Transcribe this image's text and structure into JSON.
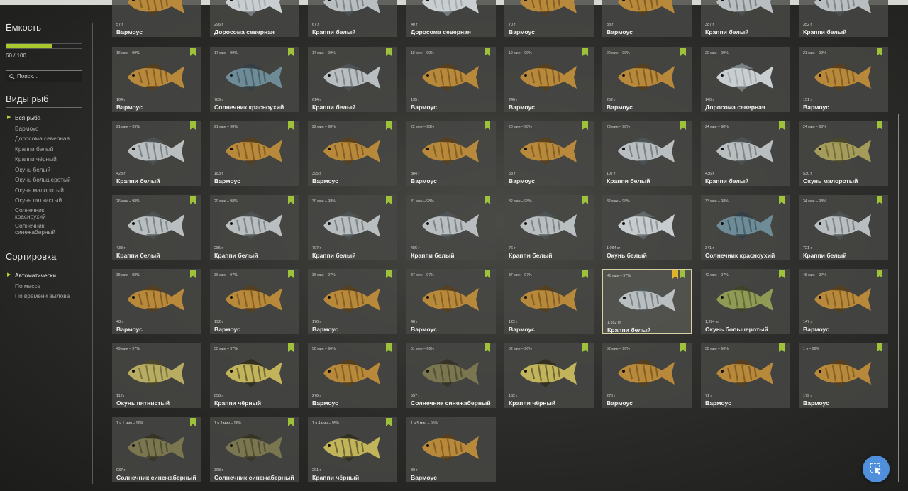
{
  "sidebar": {
    "capacity": {
      "title": "Ёмкость",
      "value": "60 / 100",
      "fraction": 0.6
    },
    "search": {
      "placeholder": "Поиск..."
    },
    "species": {
      "title": "Виды рыб",
      "items": [
        {
          "label": "Вся рыба",
          "active": true
        },
        {
          "label": "Вармоус",
          "active": false
        },
        {
          "label": "Доросома северная",
          "active": false
        },
        {
          "label": "Краппи белый",
          "active": false
        },
        {
          "label": "Краппи чёрный",
          "active": false
        },
        {
          "label": "Окунь белый",
          "active": false
        },
        {
          "label": "Окунь большеротый",
          "active": false
        },
        {
          "label": "Окунь малоротый",
          "active": false
        },
        {
          "label": "Окунь пятнистый",
          "active": false
        },
        {
          "label": "Солнечник красноухий",
          "active": false
        },
        {
          "label": "Солнечник синежаберный",
          "active": false
        }
      ]
    },
    "sort": {
      "title": "Сортировка",
      "items": [
        {
          "label": "Автоматически",
          "active": true
        },
        {
          "label": "По массе",
          "active": false
        },
        {
          "label": "По времени вылова",
          "active": false
        }
      ]
    }
  },
  "colors": {
    "accent": "#a8c82e",
    "badge": "#9ec23a",
    "star_badge": "#e0b32a",
    "help_button": "#4f8fdc"
  },
  "fish_cards": [
    {
      "info": "",
      "weight": "57 г",
      "name": "Вармоус",
      "badge": false
    },
    {
      "info": "",
      "weight": "296 г",
      "name": "Доросома северная",
      "badge": false
    },
    {
      "info": "",
      "weight": "67 г",
      "name": "Краппи белый",
      "badge": false
    },
    {
      "info": "",
      "weight": "40 г",
      "name": "Доросома северная",
      "badge": false
    },
    {
      "info": "",
      "weight": "70 г",
      "name": "Вармоус",
      "badge": false
    },
    {
      "info": "",
      "weight": "38 г",
      "name": "Вармоус",
      "badge": false
    },
    {
      "info": "",
      "weight": "387 г",
      "name": "Краппи белый",
      "badge": false
    },
    {
      "info": "",
      "weight": "352 г",
      "name": "Краппи белый",
      "badge": false
    },
    {
      "info": "16 мин – 99%",
      "weight": "164 г",
      "name": "Вармоус",
      "badge": true
    },
    {
      "info": "17 мин – 99%",
      "weight": "789 г",
      "name": "Солнечник красноухий",
      "badge": true
    },
    {
      "info": "17 мин – 99%",
      "weight": "614 г",
      "name": "Краппи белый",
      "badge": true
    },
    {
      "info": "18 мин – 99%",
      "weight": "135 г",
      "name": "Вармоус",
      "badge": true
    },
    {
      "info": "19 мин – 99%",
      "weight": "246 г",
      "name": "Вармоус",
      "badge": true
    },
    {
      "info": "20 мин – 99%",
      "weight": "252 г",
      "name": "Вармоус",
      "badge": true
    },
    {
      "info": "20 мин – 99%",
      "weight": "140 г",
      "name": "Доросома северная",
      "badge": false
    },
    {
      "info": "21 мин – 99%",
      "weight": "151 г",
      "name": "Вармоус",
      "badge": true
    },
    {
      "info": "21 мин – 99%",
      "weight": "423 г",
      "name": "Краппи белый",
      "badge": true
    },
    {
      "info": "21 мин – 98%",
      "weight": "183 г",
      "name": "Вармоус",
      "badge": true
    },
    {
      "info": "22 мин – 98%",
      "weight": "395 г",
      "name": "Вармоус",
      "badge": true
    },
    {
      "info": "22 мин – 98%",
      "weight": "384 г",
      "name": "Вармоус",
      "badge": true
    },
    {
      "info": "23 мин – 98%",
      "weight": "58 г",
      "name": "Вармоус",
      "badge": true
    },
    {
      "info": "23 мин – 98%",
      "weight": "107 г",
      "name": "Краппи белый",
      "badge": true
    },
    {
      "info": "24 мин – 98%",
      "weight": "436 г",
      "name": "Краппи белый",
      "badge": true
    },
    {
      "info": "24 мин – 98%",
      "weight": "530 г",
      "name": "Окунь малоротый",
      "badge": true
    },
    {
      "info": "26 мин – 98%",
      "weight": "433 г",
      "name": "Краппи белый",
      "badge": true
    },
    {
      "info": "29 мин – 98%",
      "weight": "285 г",
      "name": "Краппи белый",
      "badge": true
    },
    {
      "info": "30 мин – 98%",
      "weight": "707 г",
      "name": "Краппи белый",
      "badge": true
    },
    {
      "info": "31 мин – 98%",
      "weight": "486 г",
      "name": "Краппи белый",
      "badge": true
    },
    {
      "info": "32 мин – 98%",
      "weight": "76 г",
      "name": "Краппи белый",
      "badge": true
    },
    {
      "info": "32 мин – 98%",
      "weight": "1,064 кг",
      "name": "Окунь белый",
      "badge": false
    },
    {
      "info": "33 мин – 98%",
      "weight": "341 г",
      "name": "Солнечник красноухий",
      "badge": true
    },
    {
      "info": "34 мин – 98%",
      "weight": "721 г",
      "name": "Краппи белый",
      "badge": true
    },
    {
      "info": "35 мин – 98%",
      "weight": "48 г",
      "name": "Вармоус",
      "badge": true
    },
    {
      "info": "36 мин – 97%",
      "weight": "192 г",
      "name": "Вармоус",
      "badge": true
    },
    {
      "info": "36 мин – 97%",
      "weight": "176 г",
      "name": "Вармоус",
      "badge": true
    },
    {
      "info": "37 мин – 97%",
      "weight": "48 г",
      "name": "Вармоус",
      "badge": true
    },
    {
      "info": "37 мин – 97%",
      "weight": "122 г",
      "name": "Вармоус",
      "badge": true
    },
    {
      "info": "40 мин – 97%",
      "weight": "1,552 кг",
      "name": "Краппи белый",
      "badge": true,
      "star": true,
      "selected": true
    },
    {
      "info": "42 мин – 97%",
      "weight": "1,394 кг",
      "name": "Окунь большеротый",
      "badge": true
    },
    {
      "info": "48 мин – 97%",
      "weight": "147 г",
      "name": "Вармоус",
      "badge": true
    },
    {
      "info": "49 мин – 97%",
      "weight": "112 г",
      "name": "Окунь пятнистый",
      "badge": false
    },
    {
      "info": "50 мин – 97%",
      "weight": "858 г",
      "name": "Краппи чёрный",
      "badge": true
    },
    {
      "info": "50 мин – 96%",
      "weight": "276 г",
      "name": "Вармоус",
      "badge": true
    },
    {
      "info": "51 мин – 96%",
      "weight": "557 г",
      "name": "Солнечник синежаберный",
      "badge": true
    },
    {
      "info": "52 мин – 96%",
      "weight": "132 г",
      "name": "Краппи чёрный",
      "badge": true
    },
    {
      "info": "52 мин – 96%",
      "weight": "270 г",
      "name": "Вармоус",
      "badge": true
    },
    {
      "info": "58 мин – 96%",
      "weight": "71 г",
      "name": "Вармоус",
      "badge": true
    },
    {
      "info": "1 ч – 96%",
      "weight": "179 г",
      "name": "Вармоус",
      "badge": true
    },
    {
      "info": "1 ч 1 мин – 96%",
      "weight": "937 г",
      "name": "Солнечник синежаберный",
      "badge": true
    },
    {
      "info": "1 ч 3 мин – 96%",
      "weight": "368 г",
      "name": "Солнечник синежаберный",
      "badge": true
    },
    {
      "info": "1 ч 4 мин – 95%",
      "weight": "291 г",
      "name": "Краппи чёрный",
      "badge": true
    },
    {
      "info": "1 ч 5 мин – 95%",
      "weight": "80 г",
      "name": "Вармоус",
      "badge": false
    }
  ]
}
